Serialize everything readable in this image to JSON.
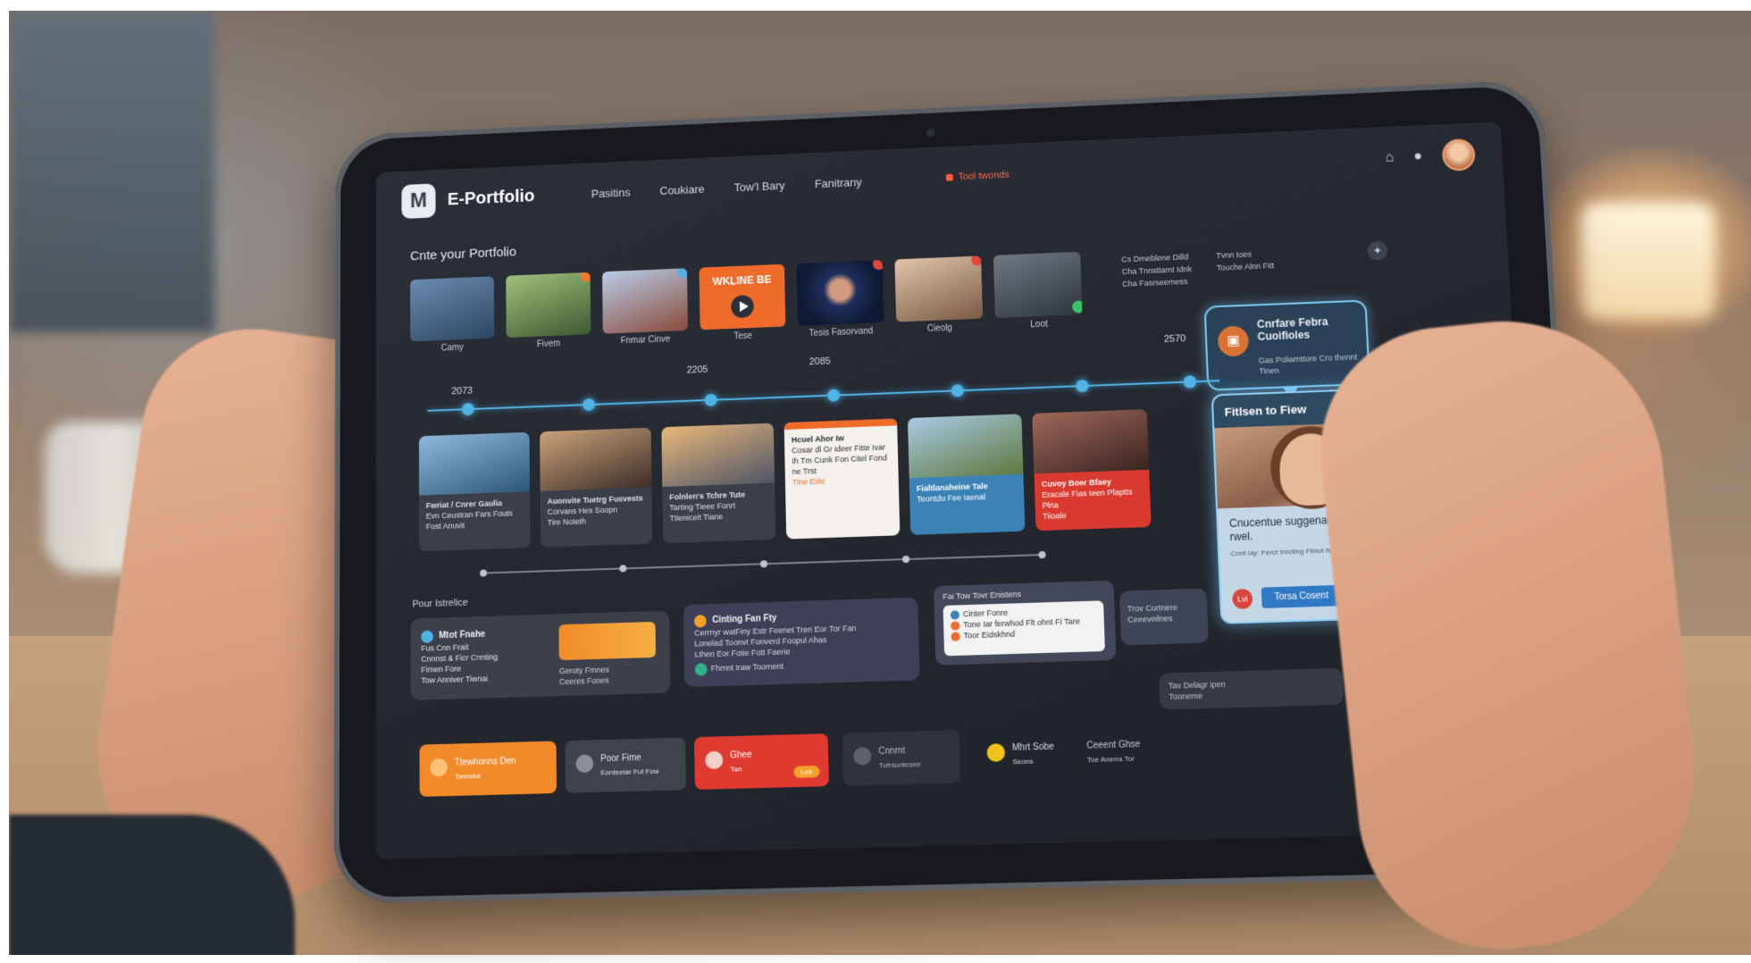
{
  "app": {
    "name": "E-Portfolio",
    "logo_letter": "M"
  },
  "nav": {
    "items": [
      "Pasitins",
      "Coukiare",
      "Tow'l Bary",
      "Fanitrany"
    ],
    "alert": "Tool twonds"
  },
  "section_title": "Cnte your Portfolio",
  "thumbnails": [
    {
      "caption": "Camy",
      "color": "#4a6a8c"
    },
    {
      "caption": "Fivem",
      "color": "#5f7d4e"
    },
    {
      "caption": "Fnmar Cinve",
      "color": "#8aa4c6"
    },
    {
      "caption": "Tese",
      "color": "#ef6b2a",
      "label": "WKLINE BE"
    },
    {
      "caption": "Tesis Fasorvand",
      "color": "#2a3e6e"
    },
    {
      "caption": "Cieolg",
      "color": "#a67b5a"
    },
    {
      "caption": "Loot",
      "color": "#4d5560"
    }
  ],
  "side_notes": [
    "Cs Drneblene Dilld",
    "Cha Tnnsttamt Idnk",
    "Cha Fasrseemess"
  ],
  "side_notes2": [
    "Tvnn toes",
    "Touche Alnn Fitt"
  ],
  "callout": {
    "title": "Cnrfare Febra Cuoifioles",
    "subtitle": "Gas Poliamttore Cro thennt Tinen"
  },
  "years": [
    "2073",
    "2205",
    "2085",
    "2570"
  ],
  "cards": [
    {
      "title": "Fwriat / Cnrer Gaulia",
      "text": "Evn Ceustran Fars Fouts",
      "footer": "Fost Anuvit"
    },
    {
      "title": "Auonvite Tuetrg Fusvests",
      "text": "Corvans Hes Soopn",
      "footer": "Tire Noteth"
    },
    {
      "title": "Folnlen's Tchre Tute",
      "text": "Tarting Tieee Fonrt",
      "footer": "Ttieniceit Tiane"
    },
    {
      "title": "Hcuel Ahor Iw",
      "text": "Cosar dl Gr ideer Fitte Ivar Ih Tm Cunk Fon Citel Fond ne Trst",
      "footer": "Tine Eiite"
    },
    {
      "title": "Fialtlanaheine Tale",
      "text": "Teontdu Fee Iaenal",
      "footer": ""
    },
    {
      "title": "Cuvoy Boer Bfaey",
      "text": "Eracale Fias teen Pfaptts Plna",
      "footer": "Tiioale"
    }
  ],
  "preview": {
    "header": "Fitlsen to Fiew",
    "message": "Cnucentue suggenation in tine ouns rwel.",
    "sub": "Cnnt lay: Ferct trecting Fllnot fe favearti.",
    "button": "Torsa Cosent",
    "circle": "Lvi"
  },
  "footer_title": "Pour Istrelice",
  "widgets": {
    "w1": {
      "title": "Mtot Fnahe",
      "lines": [
        "Fus Cnn Frait",
        "Cnnnst & Ficr Cnnting",
        "Fimen Fore",
        "Tow Anniver Tiwnai"
      ],
      "side": [
        "Geroty Fmnes",
        "Ceeres Fones"
      ]
    },
    "w2": {
      "title": "Cinting Fan Fty",
      "lines": [
        "Cerrnyr watFiny Estr Feenet Tren Eor Tor Fan",
        "Lonelad Toonvt Fonverd Foopul Ahas",
        "Lthen Eor Fotie Fott Faerie"
      ],
      "footer": "Fhmnt Iraw Tooment"
    },
    "w3": {
      "title": "Fai Tow Tovr Enistens",
      "lines": [
        "Cinter Fonre",
        "Tone Iar ferwhod Flt ohnt Fi Tare",
        "Toor Eidskhnd"
      ]
    },
    "w4": {
      "lines": [
        "Trov Cortnere",
        "Ceeeveilnes"
      ]
    },
    "w5": {
      "lines": [
        "Tav Delagr ipen",
        "Tooneme"
      ]
    }
  },
  "bottom": [
    {
      "label": "Ttewhonns Den",
      "sub": "Tannoke"
    },
    {
      "label": "Poor Fime",
      "sub": "Eonteetar Fut Fow"
    },
    {
      "label": "Ghee",
      "sub": "Tan",
      "pill": "Lelr"
    },
    {
      "label": "Cnnmt",
      "sub": "Tutrsuntesee"
    },
    {
      "label": "Mhrt Sobe",
      "sub": "Seons"
    },
    {
      "label": "Ceeent Ghse",
      "sub": "Toe Anerra Tor"
    }
  ],
  "colors": {
    "accent": "#4fb3e6",
    "orange": "#ef6b2a",
    "red": "#d9392f",
    "panel": "#2b2f38"
  }
}
